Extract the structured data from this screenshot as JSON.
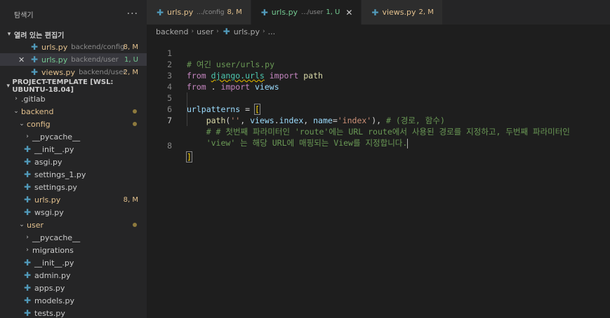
{
  "sidebar": {
    "title": "탐색기",
    "more": "···",
    "open_editors": {
      "title": "열려 있는 편집기",
      "items": [
        {
          "name": "urls.py",
          "desc": "backend/config",
          "badge": "8, M"
        },
        {
          "name": "urls.py",
          "desc": "backend/user",
          "badge": "1, U"
        },
        {
          "name": "views.py",
          "desc": "backend/user",
          "badge": "2, M"
        }
      ]
    },
    "project": {
      "title": "PROJECT-TEMPLATE [WSL: UBUNTU-18.04]",
      "tree": [
        {
          "label": ".gitlab"
        },
        {
          "label": "backend"
        },
        {
          "label": "config"
        },
        {
          "label": "__pycache__"
        },
        {
          "label": "__init__.py"
        },
        {
          "label": "asgi.py"
        },
        {
          "label": "settings_1.py"
        },
        {
          "label": "settings.py"
        },
        {
          "label": "urls.py",
          "badge": "8, M"
        },
        {
          "label": "wsgi.py"
        },
        {
          "label": "user"
        },
        {
          "label": "__pycache__"
        },
        {
          "label": "migrations"
        },
        {
          "label": "__init__.py"
        },
        {
          "label": "admin.py"
        },
        {
          "label": "apps.py"
        },
        {
          "label": "models.py"
        },
        {
          "label": "tests.py"
        }
      ]
    }
  },
  "tabs": [
    {
      "name": "urls.py",
      "desc": ".../config",
      "badge": "8, M"
    },
    {
      "name": "urls.py",
      "desc": ".../user",
      "badge": "1, U",
      "close": "✕"
    },
    {
      "name": "views.py",
      "desc": "",
      "badge": "2, M"
    }
  ],
  "breadcrumb": {
    "parts": [
      "backend",
      "user",
      "urls.py",
      "..."
    ]
  },
  "editor": {
    "line_numbers": [
      "1",
      "2",
      "3",
      "4",
      "5",
      "6",
      "7",
      "",
      "8"
    ],
    "l1": "# 여긴 user/urls.py",
    "l2_from": "from",
    "l2_mod": "django.urls",
    "l2_import": "import",
    "l2_name": "path",
    "l3_from": "from",
    "l3_dot": ".",
    "l3_import": "import",
    "l3_name": "views",
    "l5_var": "urlpatterns",
    "l5_eq": " = ",
    "l5_open": "[",
    "l6_fn": "path",
    "l6_p1": "(",
    "l6_s1": "''",
    "l6_c1": ", ",
    "l6_views": "views",
    "l6_dot": ".",
    "l6_index": "index",
    "l6_c2": ", ",
    "l6_kw": "name",
    "l6_eq": "=",
    "l6_s2": "'index'",
    "l6_p2": "), ",
    "l6_com": "# (경로, 함수)",
    "l7a": "# # 첫번째 파라미터인 'route'에는 URL route에서 사용된 경로를 지정하고, 두번째 파라미터인",
    "l7b": "'view' 는 해당 URL에 매핑되는 View를 지정합니다.",
    "l8_close": "]"
  }
}
